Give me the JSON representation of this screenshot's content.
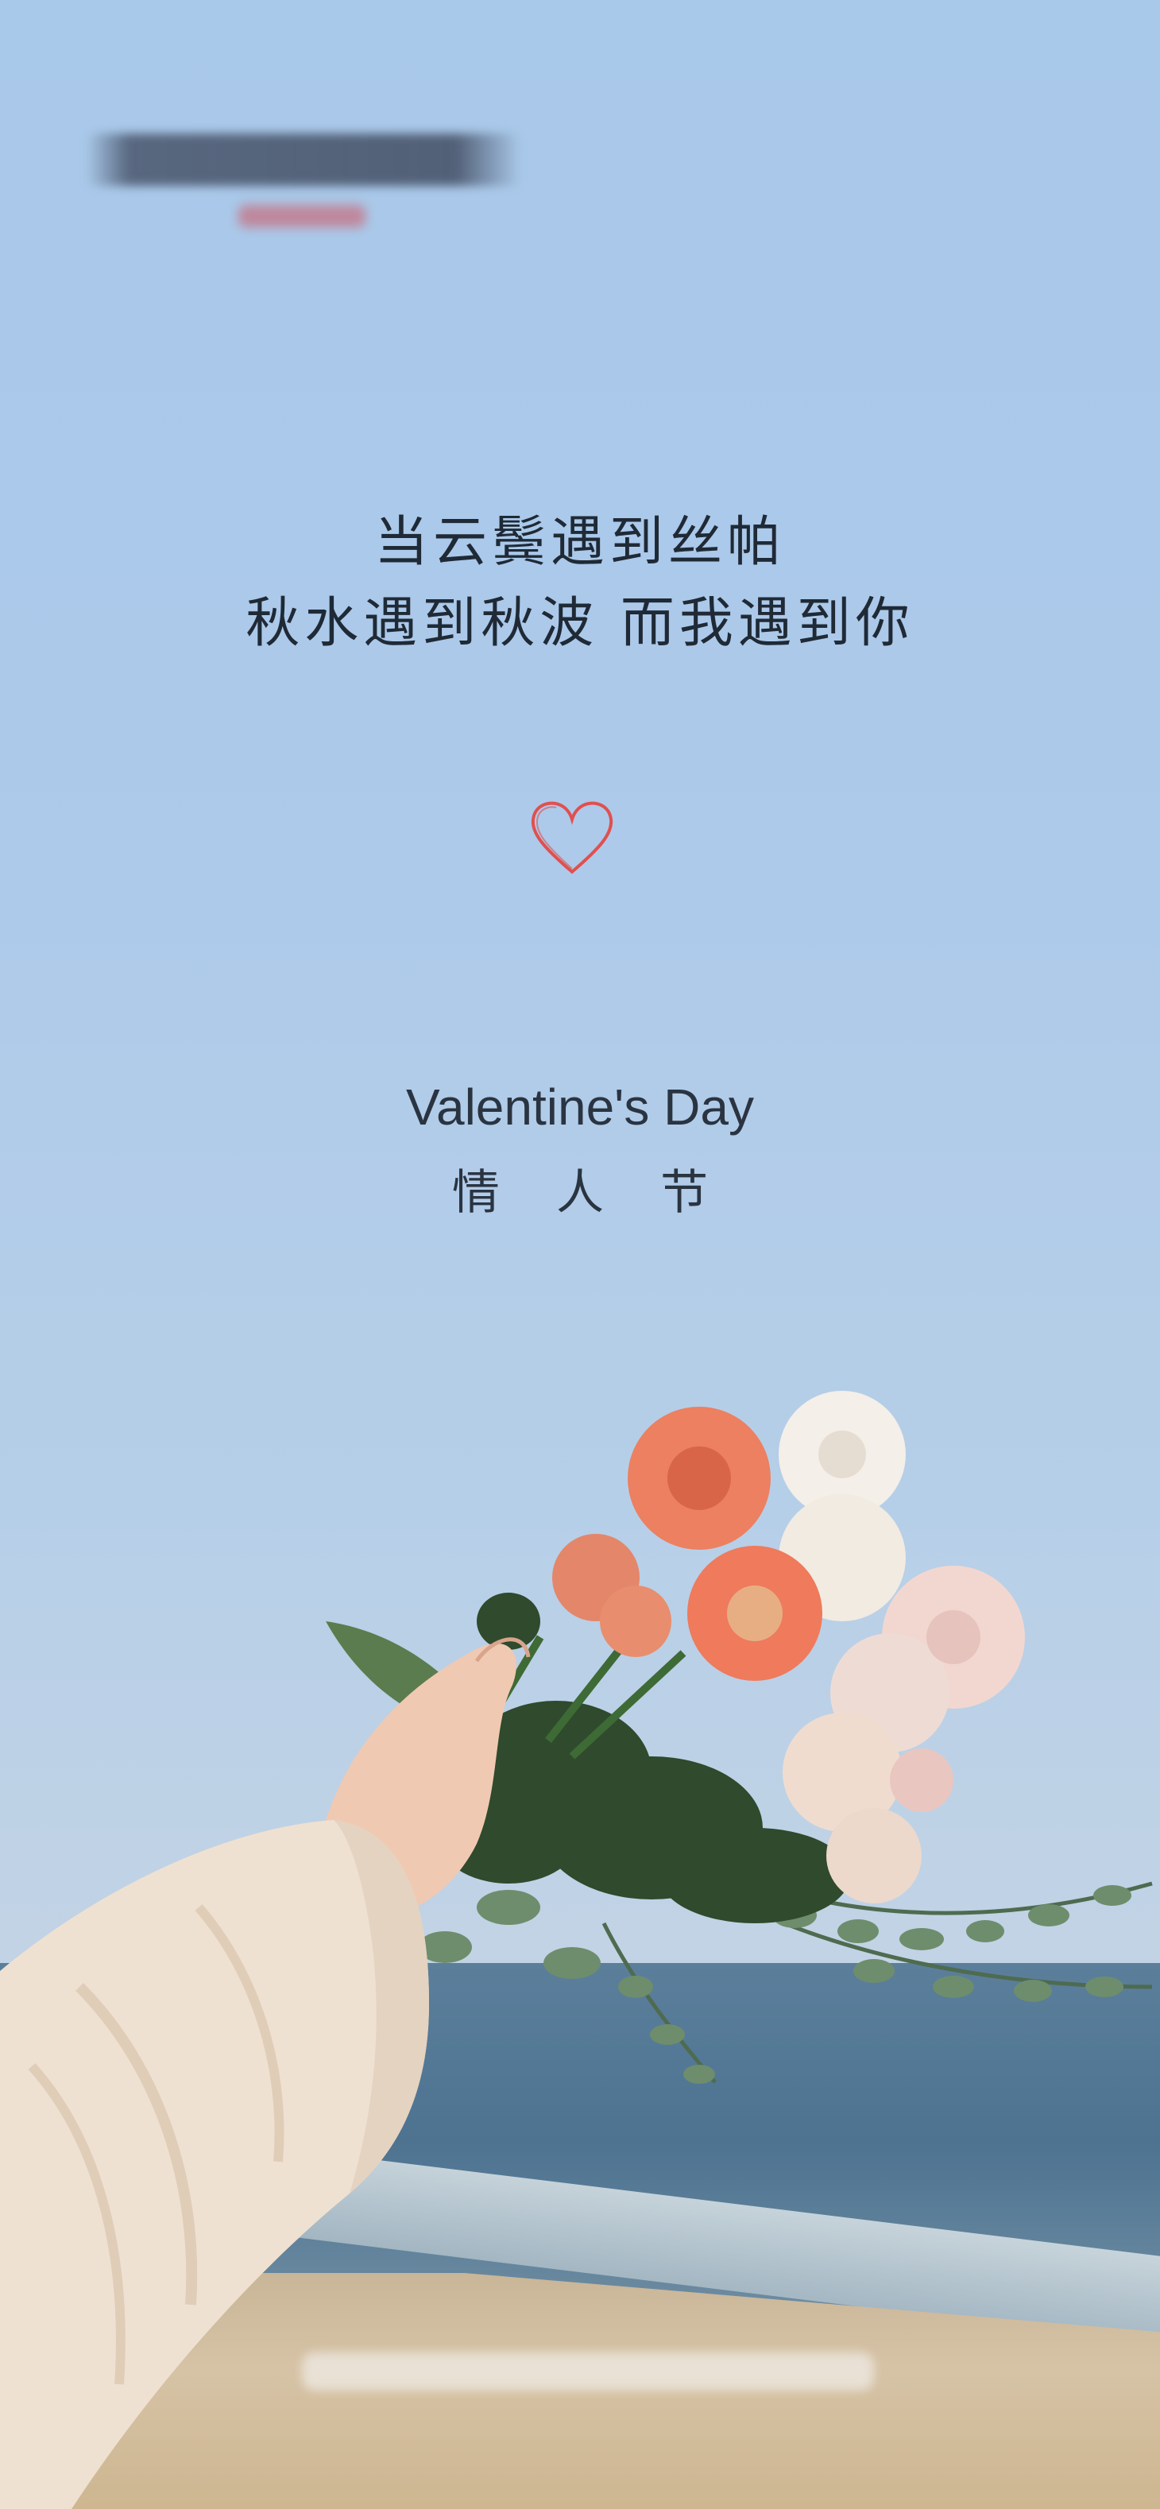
{
  "poem": {
    "line1": "当云鬓遇到丝帕",
    "line2": "秋水遇到秋波 而我遇到你"
  },
  "heading": {
    "english": "Valentine's Day",
    "chinese": "情 人 节"
  },
  "icons": {
    "heart": "heart-outline-icon"
  },
  "colors": {
    "sky": "#acc9ea",
    "text": "#1f2a36",
    "heart": "#e0504f",
    "sea": "#4d7391",
    "sand": "#d6c3a6"
  }
}
